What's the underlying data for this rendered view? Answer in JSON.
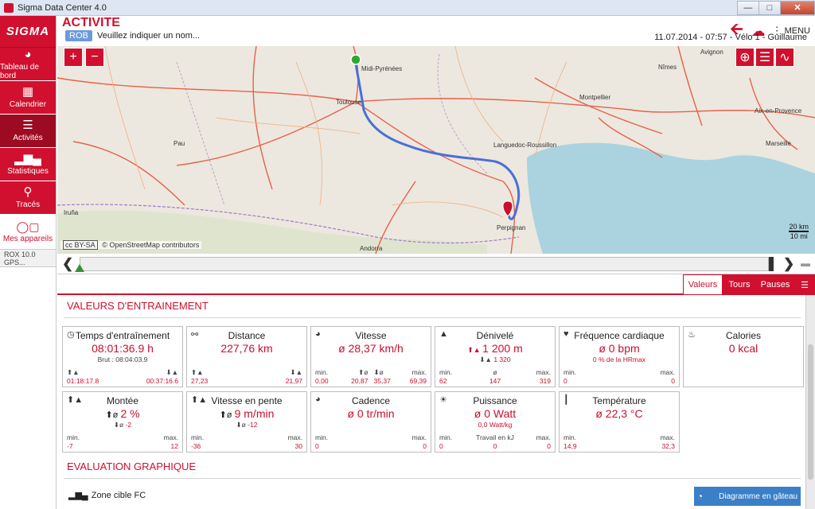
{
  "window": {
    "title": "Sigma Data Center 4.0"
  },
  "sidebar": {
    "logo": "SIGMA",
    "items": [
      {
        "label": "Tableau de bord",
        "icon": "gauge-icon"
      },
      {
        "label": "Calendrier",
        "icon": "calendar-icon"
      },
      {
        "label": "Activités",
        "icon": "list-icon"
      },
      {
        "label": "Statistiques",
        "icon": "bar-chart-icon"
      },
      {
        "label": "Tracés",
        "icon": "route-icon"
      }
    ],
    "devices_label": "Mes appareils",
    "device_name": "ROX 10.0 GPS..."
  },
  "header": {
    "title": "ACTIVITE",
    "badge": "ROB",
    "name_prompt": "Veuillez indiquer un nom...",
    "menu_label": "MENU",
    "meta": "11.07.2014 - 07:57 - Vélo 1 - Guillaume"
  },
  "map": {
    "attribution": "© OpenStreetMap contributors",
    "cc": "cc BY-SA",
    "scale_km": "20 km",
    "scale_mi": "10 mi",
    "cities": [
      {
        "name": "Toulouse"
      },
      {
        "name": "Midi-Pyrénées"
      },
      {
        "name": "Pau"
      },
      {
        "name": "Montpellier"
      },
      {
        "name": "Nîmes"
      },
      {
        "name": "Avignon"
      },
      {
        "name": "Aix-en-Provence"
      },
      {
        "name": "Marseille"
      },
      {
        "name": "Languedoc-Roussillon"
      },
      {
        "name": "Perpignan"
      },
      {
        "name": "Andorra"
      },
      {
        "name": "Iruña"
      }
    ]
  },
  "tabs": {
    "values": "Valeurs",
    "laps": "Tours",
    "pauses": "Pauses"
  },
  "section_values": "VALEURS D'ENTRAINEMENT",
  "section_graph": "EVALUATION GRAPHIQUE",
  "cards": {
    "training_time": {
      "title": "Temps d'entraînement",
      "value": "08:01:36.9 h",
      "sub": "Brut :  08:04:03.9",
      "left": "01:18:17.8",
      "right": "00:37:16.6"
    },
    "distance": {
      "title": "Distance",
      "value": "227,76 km",
      "left": "27,23",
      "right": "21,97"
    },
    "speed": {
      "title": "Vitesse",
      "value": "ø 28,37 km/h",
      "min_label": "min.",
      "min": "0,00",
      "c1": "20,87",
      "c2": "35,37",
      "max_label": "max.",
      "max": "69,39"
    },
    "altitude": {
      "title": "Dénivelé",
      "value": "1 200 m",
      "sub": "1 320",
      "min_label": "min.",
      "min": "62",
      "avg_label": "ø",
      "avg": "147",
      "max_label": "max.",
      "max": "319"
    },
    "heart_rate": {
      "title": "Fréquence cardiaque",
      "value": "ø 0 bpm",
      "sub": "0 % de la HRmax",
      "min_label": "min.",
      "min": "0",
      "max_label": "max.",
      "max": "0"
    },
    "calories": {
      "title": "Calories",
      "value": "0 kcal"
    },
    "climb": {
      "title": "Montée",
      "value": "2 %",
      "sub": "-2",
      "min_label": "min.",
      "min": "-7",
      "max_label": "max.",
      "max": "12"
    },
    "slope_speed": {
      "title": "Vitesse en pente",
      "value": "9 m/min",
      "sub": "-12",
      "min_label": "min.",
      "min": "-36",
      "max_label": "max.",
      "max": "30"
    },
    "cadence": {
      "title": "Cadence",
      "value": "ø 0 tr/min",
      "min_label": "min.",
      "min": "0",
      "max_label": "max.",
      "max": "0"
    },
    "power": {
      "title": "Puissance",
      "value": "ø 0 Watt",
      "sub": "0,0 Watt/kg",
      "min_label": "min.",
      "min": "0",
      "work_label": "Travail en kJ",
      "work": "0",
      "max_label": "max.",
      "max": "0"
    },
    "temperature": {
      "title": "Température",
      "value": "ø 22,3 °C",
      "min_label": "min.",
      "min": "14,9",
      "max_label": "max.",
      "max": "32,3"
    }
  },
  "zone_label": "Zone cible FC",
  "pie_button": "Diagramme en gâteau",
  "colors": {
    "accent": "#d0102e",
    "route": "#4a6fd6",
    "blue_button": "#3a7fc8"
  }
}
